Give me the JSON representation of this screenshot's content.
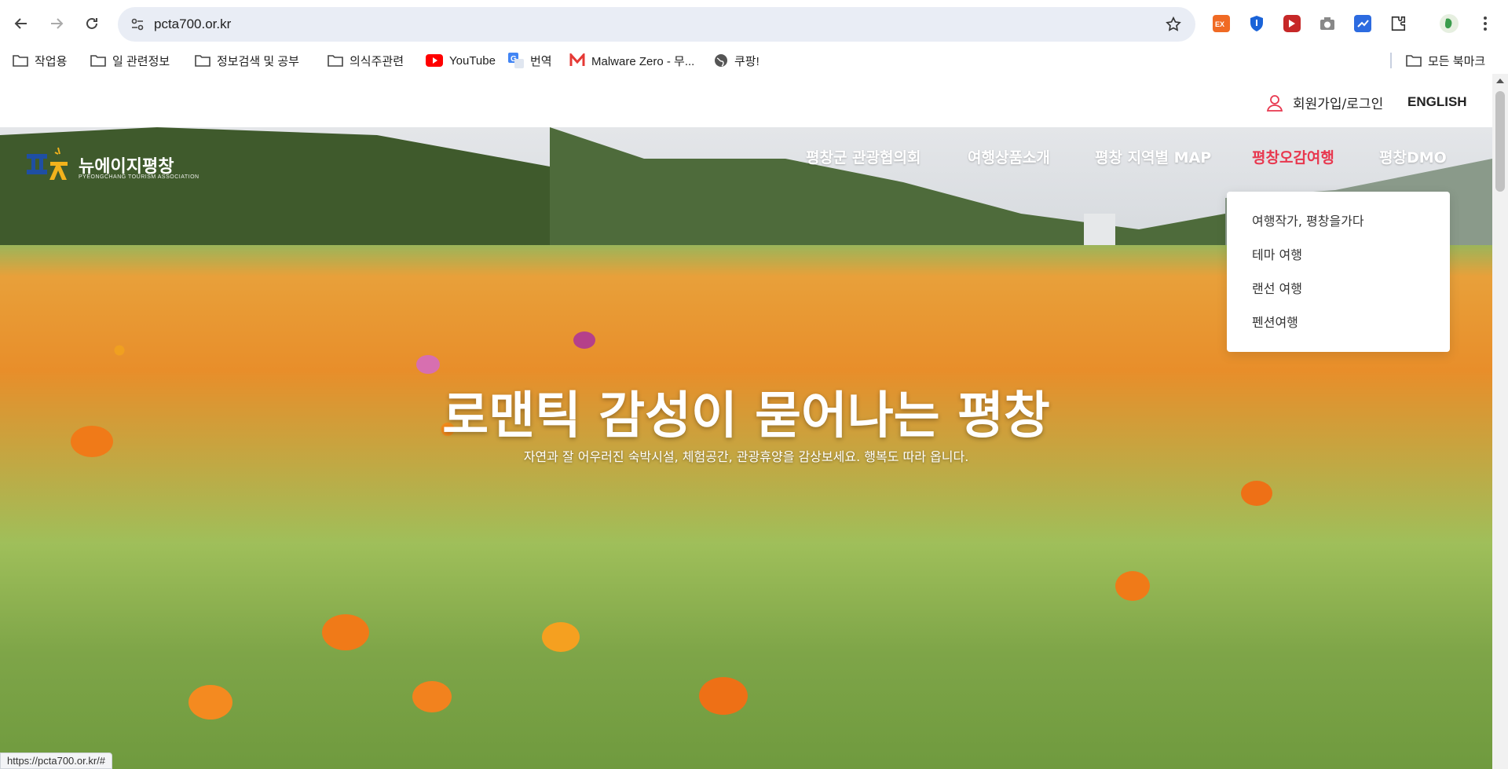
{
  "browser": {
    "url": "pcta700.or.kr",
    "bookmarks": [
      {
        "label": "작업용",
        "icon": "folder-icon"
      },
      {
        "label": "일 관련정보",
        "icon": "folder-icon"
      },
      {
        "label": "정보검색 및 공부",
        "icon": "folder-icon"
      },
      {
        "label": "의식주관련",
        "icon": "folder-icon"
      },
      {
        "label": "YouTube",
        "icon": "youtube-icon"
      },
      {
        "label": "번역",
        "icon": "translate-icon"
      },
      {
        "label": "Malware Zero - 무...",
        "icon": "malware-zero-icon"
      },
      {
        "label": "쿠팡!",
        "icon": "globe-icon"
      }
    ],
    "all_bookmarks": "모든 북마크",
    "status_url": "https://pcta700.or.kr/#"
  },
  "site": {
    "login_label": "회원가입/로그인",
    "english_label": "ENGLISH",
    "logo_text": "뉴에이지평창",
    "logo_sub": "PYEONGCHANG TOURISM ASSOCIATION",
    "menu": [
      {
        "label": "평창군 관광협의회",
        "active": false
      },
      {
        "label": "여행상품소개",
        "active": false
      },
      {
        "label": "평창 지역별 MAP",
        "active": false
      },
      {
        "label": "평창오감여행",
        "active": true
      },
      {
        "label": "평창DMO",
        "active": false
      }
    ],
    "dropdown": [
      "여행작가, 평창을가다",
      "테마 여행",
      "랜선 여행",
      "펜션여행"
    ],
    "headline": "로맨틱 감성이 묻어나는 평창",
    "subline": "자연과 잘 어우러진 숙박시설, 체험공간, 관광휴양을 감상보세요. 행복도 따라 옵니다."
  },
  "colors": {
    "accent": "#e8384f",
    "omnibox": "#e9edf5"
  }
}
